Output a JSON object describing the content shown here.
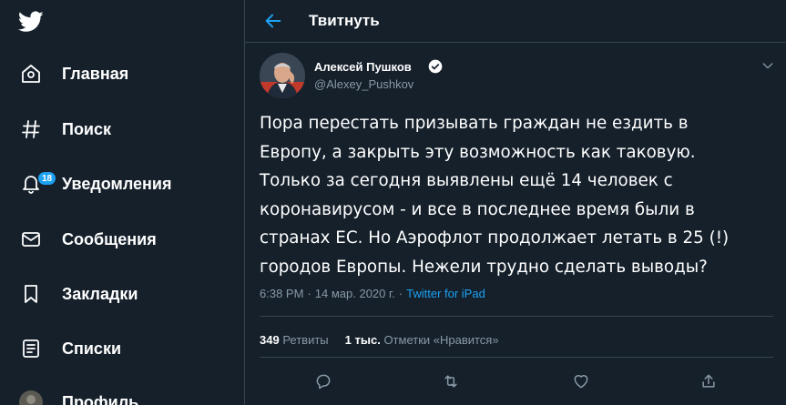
{
  "nav": {
    "items": [
      {
        "label": "Главная",
        "icon": "home-icon"
      },
      {
        "label": "Поиск",
        "icon": "hashtag-icon"
      },
      {
        "label": "Уведомления",
        "icon": "bell-icon",
        "badge": "18"
      },
      {
        "label": "Сообщения",
        "icon": "envelope-icon"
      },
      {
        "label": "Закладки",
        "icon": "bookmark-icon"
      },
      {
        "label": "Списки",
        "icon": "list-icon"
      },
      {
        "label": "Профиль",
        "icon": "avatar-icon"
      }
    ]
  },
  "header": {
    "title": "Твитнуть"
  },
  "tweet": {
    "author_name": "Алексей Пушков",
    "author_handle": "@Alexey_Pushkov",
    "text": "Пора перестать призывать граждан не ездить в\nЕвропу, а закрыть эту возможность как таковую.\nТолько за сегодня выявлены ещё 14 человек с\nкоронавирусом - и все в последнее время были в\nстранах ЕС. Но Аэрофлот продолжает летать в 25 (!)\nгородов Европы. Нежели трудно сделать выводы?",
    "time": "6:38 PM",
    "date": "14 мар. 2020 г.",
    "sep": "·",
    "source": "Twitter for iPad",
    "retweets_count": "349",
    "retweets_label": "Ретвиты",
    "likes_count": "1 тыс.",
    "likes_label": "Отметки «Нравится»"
  },
  "colors": {
    "background": "#15202b",
    "accent": "#1da1f2",
    "secondary_text": "#8899a6",
    "border": "#38444d"
  }
}
